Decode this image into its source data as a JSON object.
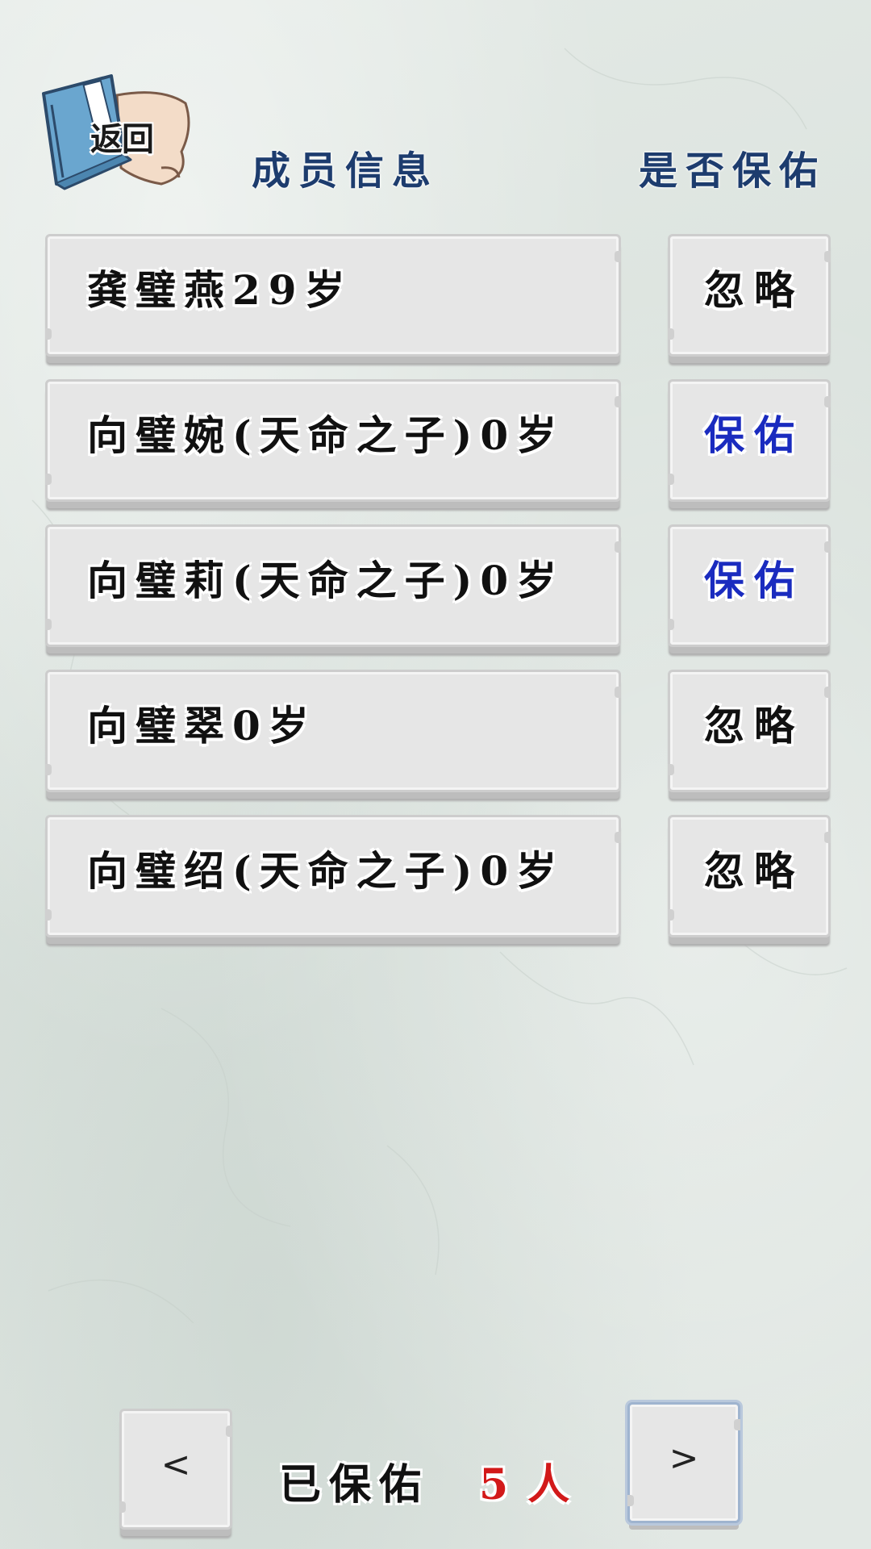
{
  "header": {
    "back_label": "返回",
    "member_info_label": "成员信息",
    "bless_question_label": "是否保佑"
  },
  "members": [
    {
      "name": "龚璧燕29岁",
      "action": "忽略",
      "action_state": "ignore"
    },
    {
      "name": "向璧婉(天命之子)0岁",
      "action": "保佑",
      "action_state": "bless"
    },
    {
      "name": "向璧莉(天命之子)0岁",
      "action": "保佑",
      "action_state": "bless"
    },
    {
      "name": "向璧翠0岁",
      "action": "忽略",
      "action_state": "ignore"
    },
    {
      "name": "向璧绍(天命之子)0岁",
      "action": "忽略",
      "action_state": "ignore"
    }
  ],
  "footer": {
    "prev_label": "<",
    "next_label": ">",
    "protected_label": "已保佑",
    "protected_count": "5",
    "protected_unit": "人"
  },
  "colors": {
    "header_text": "#1d3c6e",
    "bless_text": "#1a2bbf",
    "count_text": "#d21919"
  }
}
